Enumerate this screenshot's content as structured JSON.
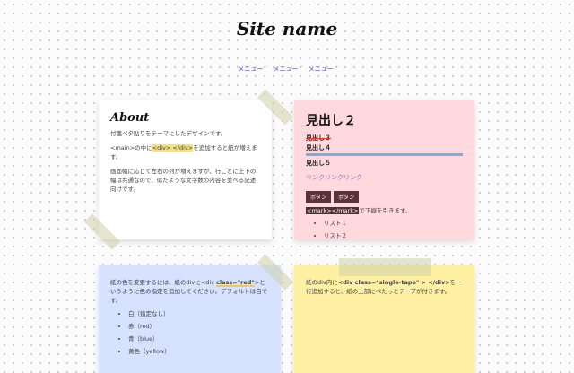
{
  "site": {
    "title": "Site name"
  },
  "nav": {
    "items": [
      "メニュー",
      "メニュー",
      "メニュー"
    ]
  },
  "about": {
    "heading": "About",
    "p1": "付箋ペタ貼りをテーマにしたデザインです。",
    "p2_pre": "<main>の中に",
    "p2_code": "<div> </div>",
    "p2_post": "を追加すると紙が増えます。",
    "p3": "画面幅に応じて左右の列が増えますが、行ごとに上下の幅は共通なので、似たような文字数の内容を並べる記述向けです。"
  },
  "red_card": {
    "h2": "見出し２",
    "h3": "見出し３",
    "h4": "見出し４",
    "h5": "見出し５",
    "link": "リンクリンクリンク",
    "buttons": [
      "ボタン",
      "ボタン"
    ],
    "mark_code": "<mark></mark>",
    "mark_text": "で下線を引きます。",
    "list": [
      "リスト１",
      "リスト２"
    ]
  },
  "blue_card": {
    "p_pre": "紙の色を変更するには、紙のdivに<div ",
    "p_code": "class=\"red\"",
    "p_post": ">というように色の指定を追加してください。デフォルトは白です。",
    "list": [
      "白（指定なし）",
      "赤（red）",
      "青（blue）",
      "黄色（yellow）"
    ]
  },
  "yellow_card": {
    "p_pre": "紙のdiv内に",
    "p_code": "<div class=\"single-tape\" > </div>",
    "p_post": "を一行追加すると、紙の上部にぺたっとテープが付きます。"
  },
  "colors": {
    "accent": "#5a4fcf",
    "red_paper": "#ffd9dd",
    "blue_paper": "#d6e2ff",
    "yellow_paper": "#fff0a3",
    "button": "#5b3236"
  }
}
